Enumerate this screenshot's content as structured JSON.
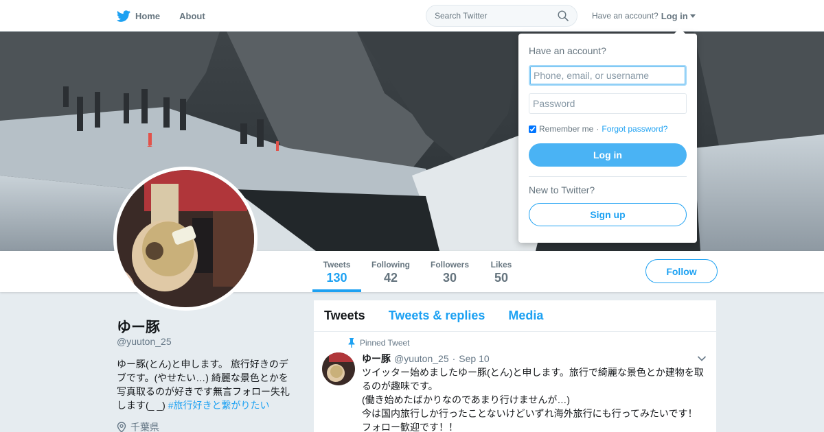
{
  "nav": {
    "home_label": "Home",
    "about_label": "About",
    "search_placeholder": "Search Twitter",
    "have_account": "Have an account?",
    "login_label": "Log in"
  },
  "profile": {
    "name": "ゆー豚",
    "handle": "@yuuton_25",
    "bio_text": "ゆー豚(とん)と申します。 旅行好きのデブです。(やせたい…) 綺麗な景色とかを写真取るのが好きです無言フォロー失礼します(_ _) ",
    "bio_hashtag": "#旅行好きと繋がりたい",
    "location": "千葉県"
  },
  "stats": [
    {
      "label": "Tweets",
      "value": "130"
    },
    {
      "label": "Following",
      "value": "42"
    },
    {
      "label": "Followers",
      "value": "30"
    },
    {
      "label": "Likes",
      "value": "50"
    }
  ],
  "follow_label": "Follow",
  "timeline": {
    "tabs": [
      "Tweets",
      "Tweets & replies",
      "Media"
    ],
    "pinned_label": "Pinned Tweet",
    "tweet": {
      "name": "ゆー豚",
      "handle": "@yuuton_25",
      "time": "Sep 10",
      "lines": [
        "ツイッター始めましたゆー豚(とん)と申します。旅行で綺麗な景色とか建物を取るのが趣味です。",
        "(働き始めたばかりなのであまり行けませんが…)",
        "今は国内旅行しか行ったことないけどいずれ海外旅行にも行ってみたいです！",
        "フォロー歓迎です！！"
      ]
    }
  },
  "login_dropdown": {
    "title": "Have an account?",
    "username_placeholder": "Phone, email, or username",
    "password_placeholder": "Password",
    "remember_label": "Remember me",
    "separator": " · ",
    "forgot_label": "Forgot password?",
    "login_button": "Log in",
    "new_label": "New to Twitter?",
    "signup_button": "Sign up"
  },
  "colors": {
    "accent": "#1da1f2",
    "login_button": "#4ab3f4",
    "background": "#e6ecf0"
  },
  "icons": [
    "twitter-bird-icon",
    "home-icon",
    "search-icon",
    "caret-down-icon",
    "pin-icon",
    "location-pin-icon",
    "chevron-down-icon"
  ]
}
